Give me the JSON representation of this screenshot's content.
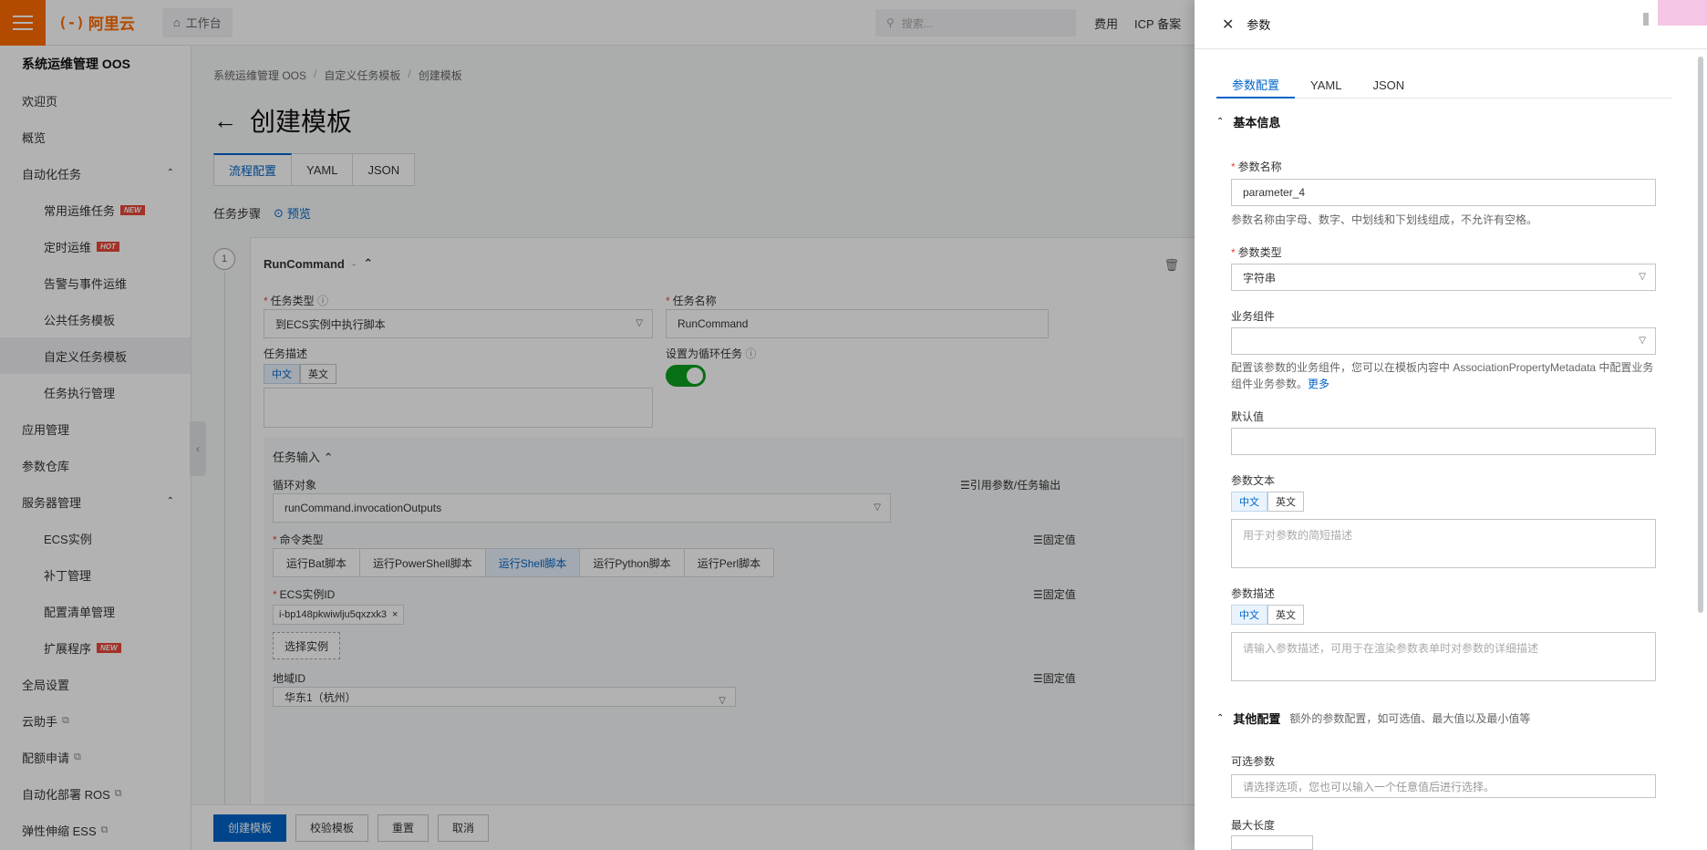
{
  "topbar": {
    "logo_mark": "(-)",
    "logo_text": "阿里云",
    "workbench": "工作台",
    "search_placeholder": "搜索...",
    "nav": [
      "费用",
      "ICP 备案"
    ]
  },
  "sidebar": {
    "title": "系统运维管理 OOS",
    "items": [
      {
        "label": "欢迎页",
        "level": 0
      },
      {
        "label": "概览",
        "level": 0
      },
      {
        "label": "自动化任务",
        "level": 0,
        "expanded": true
      },
      {
        "label": "常用运维任务",
        "level": 1,
        "badge": "NEW"
      },
      {
        "label": "定时运维",
        "level": 1,
        "badge": "HOT"
      },
      {
        "label": "告警与事件运维",
        "level": 1
      },
      {
        "label": "公共任务模板",
        "level": 1
      },
      {
        "label": "自定义任务模板",
        "level": 1,
        "active": true
      },
      {
        "label": "任务执行管理",
        "level": 1
      },
      {
        "label": "应用管理",
        "level": 0
      },
      {
        "label": "参数仓库",
        "level": 0
      },
      {
        "label": "服务器管理",
        "level": 0,
        "expanded": true
      },
      {
        "label": "ECS实例",
        "level": 1
      },
      {
        "label": "补丁管理",
        "level": 1
      },
      {
        "label": "配置清单管理",
        "level": 1
      },
      {
        "label": "扩展程序",
        "level": 1,
        "badge": "NEW"
      },
      {
        "label": "全局设置",
        "level": 0
      },
      {
        "label": "云助手",
        "level": 0,
        "external": true
      },
      {
        "label": "配额申请",
        "level": 0,
        "external": true
      },
      {
        "label": "自动化部署 ROS",
        "level": 0,
        "external": true
      },
      {
        "label": "弹性伸缩 ESS",
        "level": 0,
        "external": true
      }
    ]
  },
  "main": {
    "breadcrumb": [
      "系统运维管理 OOS",
      "自定义任务模板",
      "创建模板"
    ],
    "title": "创建模板",
    "tabs": [
      "流程配置",
      "YAML",
      "JSON"
    ],
    "active_tab": "流程配置",
    "steps_label": "任务步骤",
    "preview": "预览",
    "step": {
      "number": "1",
      "name": "RunCommand",
      "dash": "-",
      "task_type_label": "任务类型",
      "task_type_value": "到ECS实例中执行脚本",
      "task_name_label": "任务名称",
      "task_name_value": "RunCommand",
      "task_desc_label": "任务描述",
      "lang_zh": "中文",
      "lang_en": "英文",
      "loop_label": "设置为循环任务",
      "input_title": "任务输入",
      "loop_target_label": "循环对象",
      "loop_target_value": "runCommand.invocationOutputs",
      "ref_link": "引用参数/任务输出",
      "fixed_link": "固定值",
      "cmd_type_label": "命令类型",
      "cmd_types": [
        "运行Bat脚本",
        "运行PowerShell脚本",
        "运行Shell脚本",
        "运行Python脚本",
        "运行Perl脚本"
      ],
      "cmd_type_active": "运行Shell脚本",
      "instance_label": "ECS实例ID",
      "instance_tag": "i-bp148pkwiwlju5qxzxk3",
      "select_instance": "选择实例",
      "region_label": "地域ID",
      "region_value": "华东1（杭州）"
    }
  },
  "footer": {
    "create": "创建模板",
    "validate": "校验模板",
    "reset": "重置",
    "cancel": "取消"
  },
  "drawer": {
    "title": "参数",
    "tabs": [
      "参数配置",
      "YAML",
      "JSON"
    ],
    "active_tab": "参数配置",
    "basic_section": "基本信息",
    "name_label": "参数名称",
    "name_value": "parameter_4",
    "name_help": "参数名称由字母、数字、中划线和下划线组成，不允许有空格。",
    "type_label": "参数类型",
    "type_value": "字符串",
    "component_label": "业务组件",
    "component_help": "配置该参数的业务组件，您可以在模板内容中 AssociationPropertyMetadata 中配置业务组件业务参数。",
    "more": "更多",
    "default_label": "默认值",
    "text_label": "参数文本",
    "text_placeholder": "用于对参数的简短描述",
    "desc_label": "参数描述",
    "desc_placeholder": "请输入参数描述，可用于在渲染参数表单时对参数的详细描述",
    "lang_zh": "中文",
    "lang_en": "英文",
    "other_section": "其他配置",
    "other_desc": "额外的参数配置，如可选值、最大值以及最小值等",
    "options_label": "可选参数",
    "options_placeholder": "请选择选项，您也可以输入一个任意值后进行选择。",
    "maxlen_label": "最大长度"
  },
  "colors": {
    "brand": "#ff6a00",
    "primary": "#0064c8",
    "toggle_on": "#0ca01f",
    "badge": "#e84738"
  }
}
